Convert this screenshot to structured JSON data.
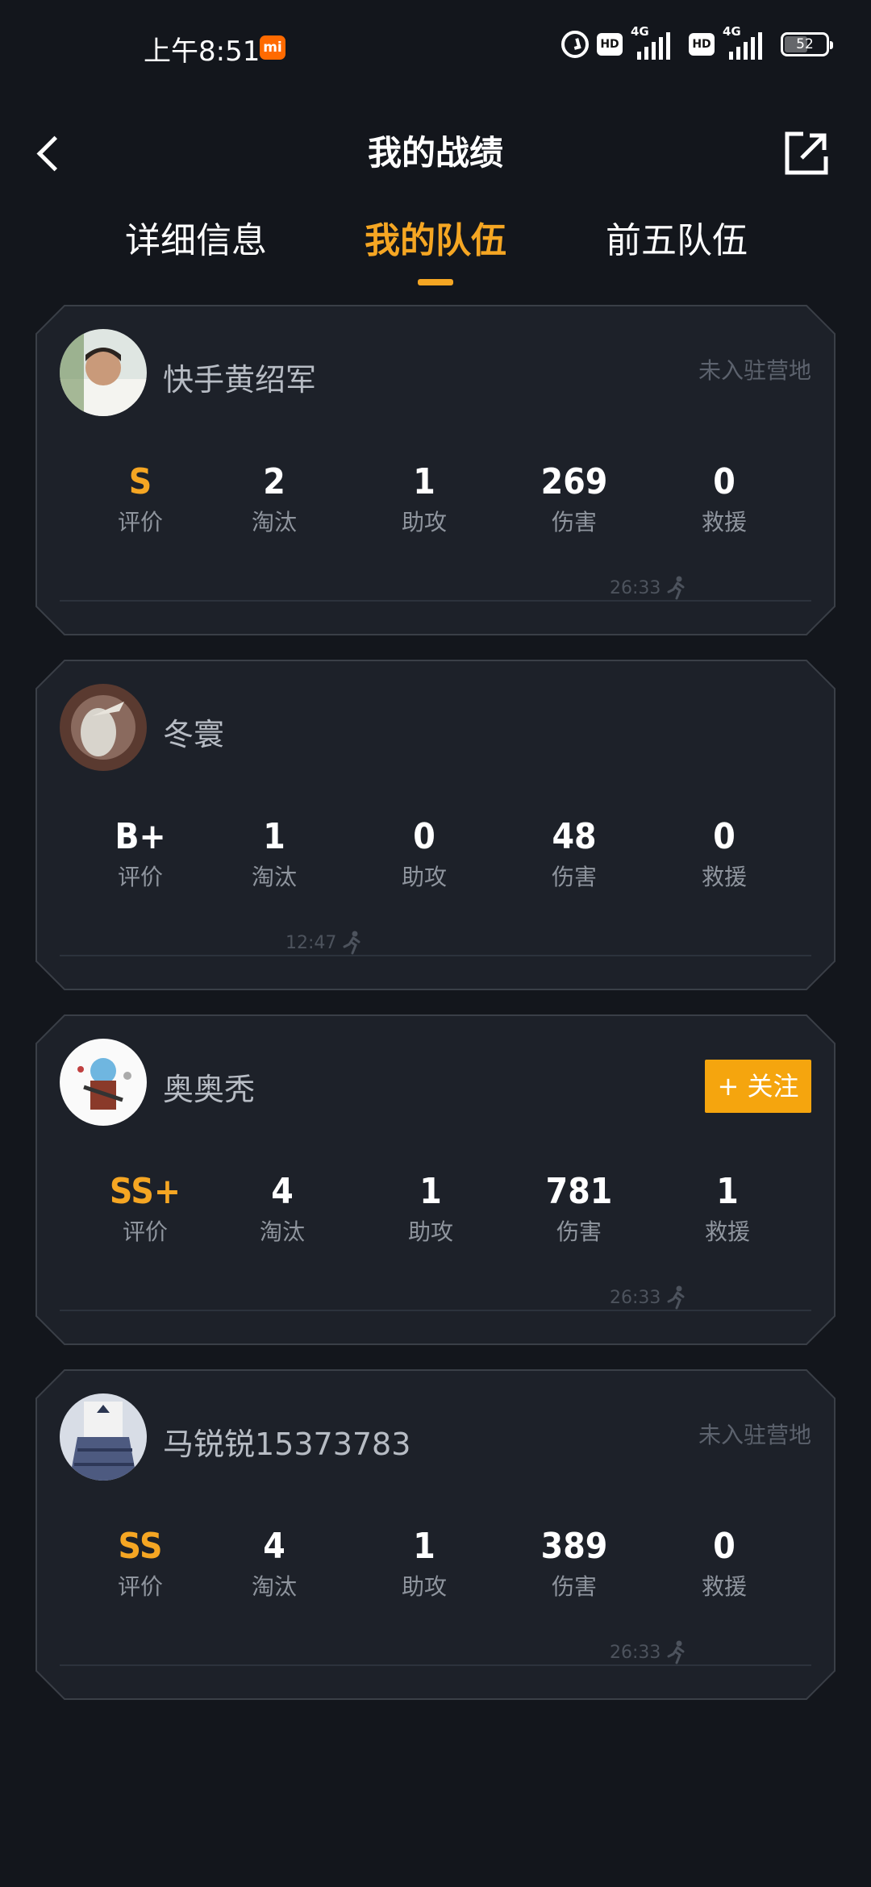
{
  "status_bar": {
    "time": "上午8:51",
    "mi_badge": "mi",
    "hd1": "HD",
    "net1": "4G",
    "hd2": "HD",
    "net2": "4G",
    "battery": "52",
    "battery_level": 0.52
  },
  "header": {
    "title": "我的战绩",
    "back_icon": "chevron-left-icon",
    "share_icon": "share-icon"
  },
  "tabs": [
    {
      "label": "详细信息",
      "active": false
    },
    {
      "label": "我的队伍",
      "active": true
    },
    {
      "label": "前五队伍",
      "active": false
    }
  ],
  "stat_labels": [
    "评价",
    "淘汰",
    "助攻",
    "伤害",
    "救援"
  ],
  "players": [
    {
      "name": "快手黄绍军",
      "camp_status": "未入驻营地",
      "follow": null,
      "stats": {
        "rating": "S",
        "kills": "2",
        "assists": "1",
        "damage": "269",
        "rescues": "0"
      },
      "survival_time": "26:33"
    },
    {
      "name": "冬寰",
      "camp_status": "",
      "follow": null,
      "stats": {
        "rating": "B+",
        "kills": "1",
        "assists": "0",
        "damage": "48",
        "rescues": "0"
      },
      "survival_time": "12:47"
    },
    {
      "name": "奥奥秃",
      "camp_status": "",
      "follow": "+ 关注",
      "stats": {
        "rating": "SS+",
        "kills": "4",
        "assists": "1",
        "damage": "781",
        "rescues": "1"
      },
      "survival_time": "26:33"
    },
    {
      "name": "马锐锐15373783",
      "camp_status": "未入驻营地",
      "follow": null,
      "stats": {
        "rating": "SS",
        "kills": "4",
        "assists": "1",
        "damage": "389",
        "rescues": "0"
      },
      "survival_time": "26:33"
    }
  ],
  "colors": {
    "accent": "#f5a623",
    "background": "#13161c",
    "card": "#1d2129",
    "card_border": "#3a3f47"
  }
}
